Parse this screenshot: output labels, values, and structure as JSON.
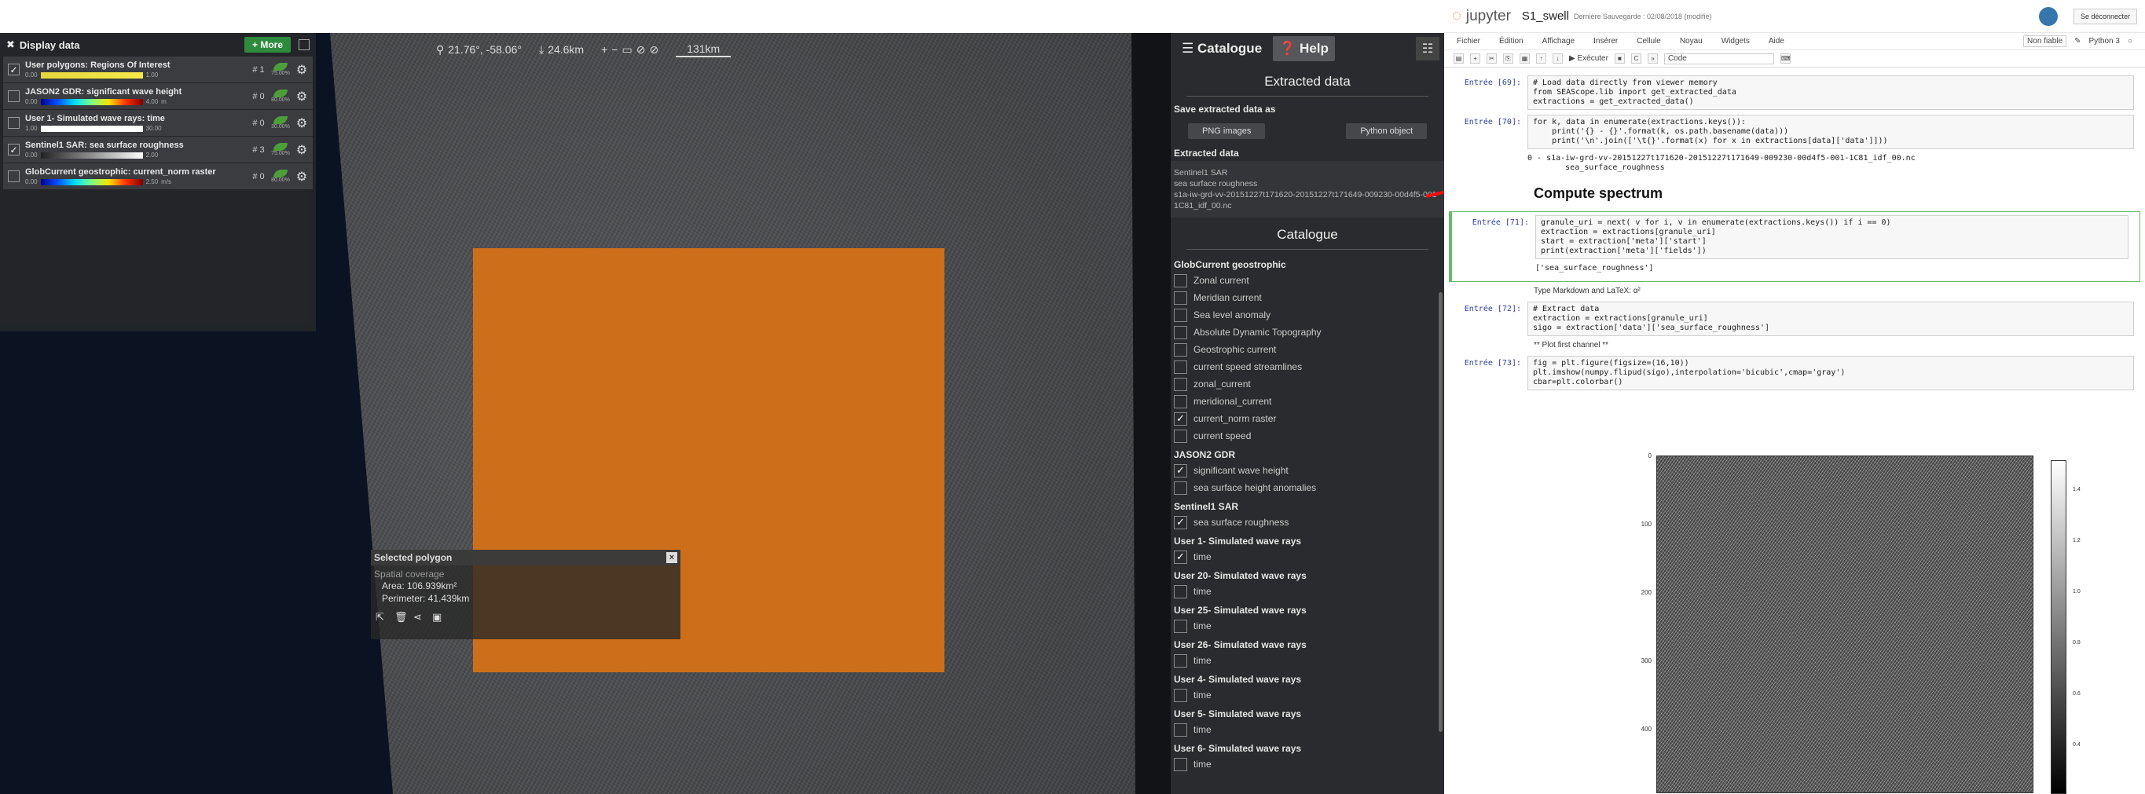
{
  "viewer": {
    "toolbar": {
      "coords": "21.76°, -58.06°",
      "alt": "24.6km",
      "scale": "131km"
    },
    "layers_panel": {
      "title": "Display data",
      "more_label": "+ More",
      "layers": [
        {
          "name": "User polygons: Regions Of Interest",
          "checked": true,
          "idx": "# 1",
          "min": "0.00",
          "max": "1.00",
          "unit": "",
          "opacity": "75.00%",
          "colormap": "yellow"
        },
        {
          "name": "JASON2 GDR: significant wave height",
          "checked": false,
          "idx": "# 0",
          "min": "0.00",
          "max": "4.00",
          "unit": "m",
          "opacity": "80.00%",
          "colormap": "jet"
        },
        {
          "name": "User 1- Simulated wave rays: time",
          "checked": false,
          "idx": "# 0",
          "min": "1.00",
          "max": "30.00",
          "unit": "",
          "opacity": "30.00%",
          "colormap": "white"
        },
        {
          "name": "Sentinel1 SAR: sea surface roughness",
          "checked": true,
          "idx": "# 3",
          "min": "0.00",
          "max": "2.00",
          "unit": "",
          "opacity": "75.00%",
          "colormap": "gray"
        },
        {
          "name": "GlobCurrent geostrophic: current_norm raster",
          "checked": false,
          "idx": "# 0",
          "min": "0.00",
          "max": "2.50",
          "unit": "m/s",
          "opacity": "80.00%",
          "colormap": "jet"
        }
      ]
    },
    "selected_polygon": {
      "title": "Selected polygon",
      "close": "×",
      "subtitle": "Spatial coverage",
      "area": "Area: 106.939km²",
      "perimeter": "Perimeter: 41.439km"
    },
    "side": {
      "tab_catalogue": "Catalogue",
      "tab_help": "Help",
      "extracted_title": "Extracted data",
      "save_label": "Save extracted data as",
      "btn_png": "PNG images",
      "btn_python": "Python object",
      "extracted_data_label": "Extracted data",
      "extracted_text": "Sentinel1 SAR\nsea surface roughness\ns1a-iw-grd-vv-20151227t171620-20151227t171649-009230-00d4f5-001-1C81_idf_00.nc",
      "catalogue_title": "Catalogue",
      "groups": [
        {
          "title": "GlobCurrent geostrophic",
          "items": [
            {
              "label": "Zonal current",
              "checked": false
            },
            {
              "label": "Meridian current",
              "checked": false
            },
            {
              "label": "Sea level anomaly",
              "checked": false
            },
            {
              "label": "Absolute Dynamic Topography",
              "checked": false
            },
            {
              "label": "Geostrophic current",
              "checked": false
            },
            {
              "label": "current speed streamlines",
              "checked": false
            },
            {
              "label": "zonal_current",
              "checked": false
            },
            {
              "label": "meridional_current",
              "checked": false
            },
            {
              "label": "current_norm raster",
              "checked": true
            },
            {
              "label": "current speed",
              "checked": false
            }
          ]
        },
        {
          "title": "JASON2 GDR",
          "items": [
            {
              "label": "significant wave height",
              "checked": true
            },
            {
              "label": "sea surface height anomalies",
              "checked": false
            }
          ]
        },
        {
          "title": "Sentinel1 SAR",
          "items": [
            {
              "label": "sea surface roughness",
              "checked": true
            }
          ]
        },
        {
          "title": "User 1- Simulated wave rays",
          "items": [
            {
              "label": "time",
              "checked": true
            }
          ]
        },
        {
          "title": "User 20- Simulated wave rays",
          "items": [
            {
              "label": "time",
              "checked": false
            }
          ]
        },
        {
          "title": "User 25- Simulated wave rays",
          "items": [
            {
              "label": "time",
              "checked": false
            }
          ]
        },
        {
          "title": "User 26- Simulated wave rays",
          "items": [
            {
              "label": "time",
              "checked": false
            }
          ]
        },
        {
          "title": "User 4- Simulated wave rays",
          "items": [
            {
              "label": "time",
              "checked": false
            }
          ]
        },
        {
          "title": "User 5- Simulated wave rays",
          "items": [
            {
              "label": "time",
              "checked": false
            }
          ]
        },
        {
          "title": "User 6- Simulated wave rays",
          "items": [
            {
              "label": "time",
              "checked": false
            }
          ]
        }
      ]
    }
  },
  "jupyter": {
    "brand": "jupyter",
    "notebook": "S1_swell",
    "save_status": "Dernière Sauvegarde : 02/08/2018 (modifié)",
    "logout": "Se déconnecter",
    "menu": [
      "Fichier",
      "Édition",
      "Affichage",
      "Insérer",
      "Cellule",
      "Noyau",
      "Widgets",
      "Aide"
    ],
    "not_trusted": "Non fiable",
    "kernel": "Python 3",
    "run_label": "Exécuter",
    "cell_type": "Code",
    "cells": [
      {
        "prompt": "Entrée [69]:",
        "code": "# Load data directly from viewer memory\nfrom SEAScope.lib import get_extracted_data\nextractions = get_extracted_data()"
      },
      {
        "prompt": "Entrée [70]:",
        "code": "for k, data in enumerate(extractions.keys()):\n    print('{} - {}'.format(k, os.path.basename(data)))\n    print('\\n'.join(['\\t{}'.format(x) for x in extractions[data]['data']]))",
        "output": "0 - s1a-iw-grd-vv-20151227t171620-20151227t171649-009230-00d4f5-001-1C81_idf_00.nc\n        sea_surface_roughness"
      },
      {
        "markdown_h2": "Compute spectrum"
      },
      {
        "prompt": "Entrée [71]:",
        "code": "granule_uri = next( v for i, v in enumerate(extractions.keys()) if i == 0)\nextraction = extractions[granule_uri]\nstart = extraction['meta']['start']\nprint(extraction['meta']['fields'])",
        "output": "['sea_surface_roughness']",
        "selected": true
      },
      {
        "markdown": "Type Markdown and LaTeX: α²"
      },
      {
        "prompt": "Entrée [72]:",
        "code": "# Extract data\nextraction = extractions[granule_uri]\nsigo = extraction['data']['sea_surface_roughness']"
      },
      {
        "markdown": "** Plot first channel **"
      },
      {
        "prompt": "Entrée [73]:",
        "code": "fig = plt.figure(figsize=(16,10))\nplt.imshow(numpy.flipud(sigo),interpolation='bicubic',cmap='gray')\ncbar=plt.colorbar()"
      }
    ],
    "plot": {
      "yticks": [
        "0",
        "100",
        "200",
        "300",
        "400"
      ],
      "cticks": [
        "1.4",
        "1.2",
        "1.0",
        "0.8",
        "0.6",
        "0.4"
      ]
    }
  }
}
